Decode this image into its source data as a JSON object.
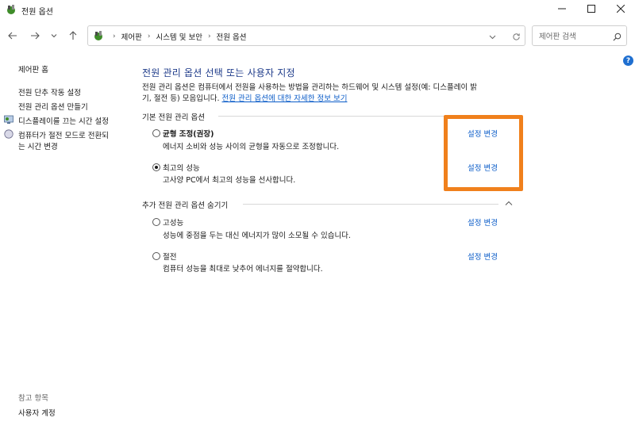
{
  "window": {
    "title": "전원 옵션"
  },
  "breadcrumb": [
    "제어판",
    "시스템 및 보안",
    "전원 옵션"
  ],
  "search": {
    "placeholder": "제어판 검색"
  },
  "sidebar": {
    "home": "제어판 홈",
    "items": [
      {
        "label": "전원 단추 작동 설정"
      },
      {
        "label": "전원 관리 옵션 만들기"
      },
      {
        "label": "디스플레이를 끄는 시간 설정"
      },
      {
        "label_line1": "컴퓨터가 절전 모드로 전환되",
        "label_line2": "는 시간 변경"
      }
    ],
    "see_also": "참고 항목",
    "user_accounts": "사용자 계정"
  },
  "main": {
    "title": "전원 관리 옵션 선택 또는 사용자 지정",
    "desc_line1": "전원 관리 옵션은 컴퓨터에서 전원을 사용하는 방법을 관리하는 하드웨어 및 시스템 설정(예: 디스플레이 밝",
    "desc_line2_prefix": "기, 절전 등) 모음입니다.",
    "desc_link": "전원 관리 옵션에 대한 자세한 정보 보기",
    "basic_header": "기본 전원 관리 옵션",
    "additional_header": "추가 전원 관리 옵션 숨기기",
    "change_label": "설정 변경",
    "plans": [
      {
        "name": "균형 조정(권장)",
        "desc": "에너지 소비와 성능 사이의 균형을 자동으로 조정합니다.",
        "selected": false
      },
      {
        "name": "최고의 성능",
        "desc": "고사양 PC에서 최고의 성능을 선사합니다.",
        "selected": true
      },
      {
        "name": "고성능",
        "desc": "성능에 중점을 두는 대신 에너지가 많이 소모될 수 있습니다.",
        "selected": false
      },
      {
        "name": "절전",
        "desc": "컴퓨터 성능을 최대로 낮추어 에너지를 절약합니다.",
        "selected": false
      }
    ]
  },
  "colors": {
    "highlight": "#f0801c",
    "link": "#0b5cc8",
    "title": "#1e3b8a"
  }
}
